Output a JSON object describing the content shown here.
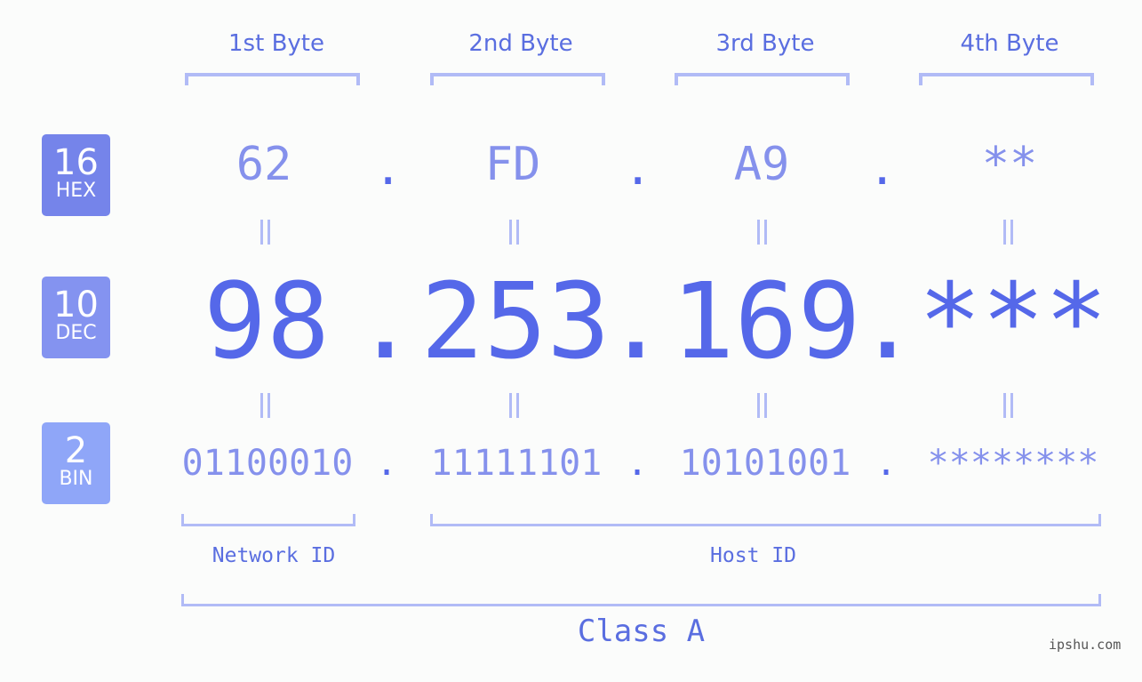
{
  "bytes": [
    {
      "label": "1st Byte",
      "hex": "62",
      "dec": "98",
      "bin": "01100010"
    },
    {
      "label": "2nd Byte",
      "hex": "FD",
      "dec": "253",
      "bin": "11111101"
    },
    {
      "label": "3rd Byte",
      "hex": "A9",
      "dec": "169",
      "bin": "10101001"
    },
    {
      "label": "4th Byte",
      "hex": "**",
      "dec": "***",
      "bin": "********"
    }
  ],
  "separator": ".",
  "bases": [
    {
      "num": "16",
      "name": "HEX",
      "color": "#7584ea"
    },
    {
      "num": "10",
      "name": "DEC",
      "color": "#8493f0"
    },
    {
      "num": "2",
      "name": "BIN",
      "color": "#8fa6f8"
    }
  ],
  "network_label": "Network ID",
  "host_label": "Host ID",
  "class_label": "Class A",
  "watermark": "ipshu.com"
}
